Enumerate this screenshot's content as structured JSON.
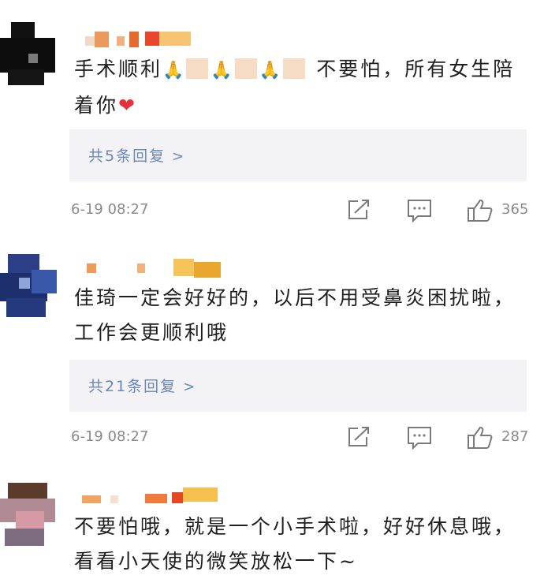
{
  "comments": [
    {
      "text_parts": [
        "手术顺利",
        "🙏",
        "🙏",
        "🙏",
        "不要怕，所有女生陪着你",
        "❤"
      ],
      "reply_label": "共5条回复",
      "time": "6-19 08:27",
      "likes": "365"
    },
    {
      "text": "佳琦一定会好好的，以后不用受鼻炎困扰啦，工作会更顺利哦",
      "reply_label": "共21条回复",
      "time": "6-19 08:27",
      "likes": "287"
    },
    {
      "text": "不要怕哦，就是一个小手术啦，好好休息哦，看看小天使的微笑放松一下~"
    }
  ],
  "colors": {
    "reply_link": "#6b86b8",
    "reply_bg": "#f3f3f5",
    "heart": "#e8313a",
    "meta": "#8a8a8a"
  },
  "icons": {
    "share": "share-icon",
    "comment": "comment-icon",
    "like": "thumbs-up-icon"
  }
}
